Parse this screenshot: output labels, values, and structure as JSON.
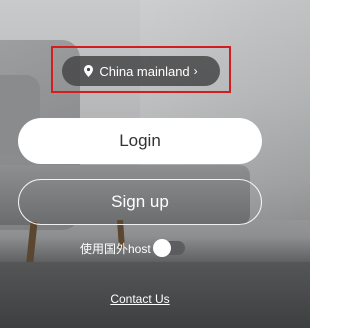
{
  "region": {
    "label": "China mainland",
    "chevron": "›",
    "icon": "location-pin-icon"
  },
  "login": {
    "label": "Login"
  },
  "signup": {
    "label": "Sign up"
  },
  "host": {
    "label": "使用国外host",
    "enabled": false
  },
  "contact": {
    "label": "Contact Us"
  },
  "colors": {
    "highlight": "#d21e1e",
    "pill_bg": "#464648"
  }
}
